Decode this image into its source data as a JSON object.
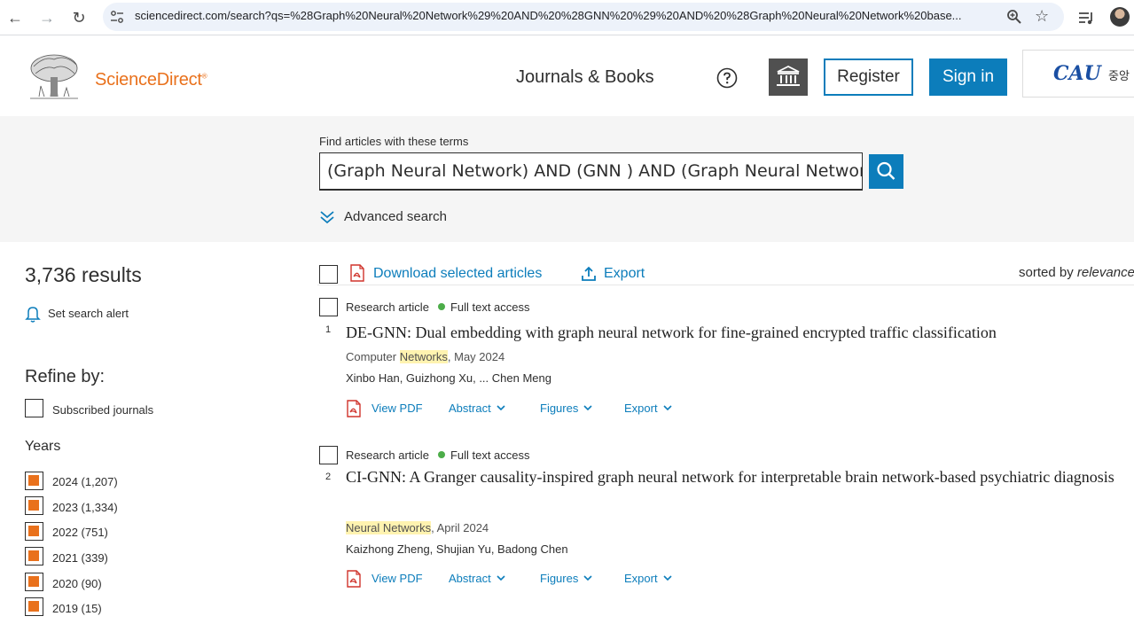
{
  "browser": {
    "url": "sciencedirect.com/search?qs=%28Graph%20Neural%20Network%29%20AND%20%28GNN%20%29%20AND%20%28Graph%20Neural%20Network%20base..."
  },
  "header": {
    "brand": "ScienceDirect",
    "brand_mark": "®",
    "journals_books": "Journals & Books",
    "register_label": "Register",
    "signin_label": "Sign in",
    "institution_logo_text": "CAU",
    "institution_name_partial": "중앙"
  },
  "search": {
    "label": "Find articles with these terms",
    "query": "(Graph Neural Network) AND (GNN ) AND (Graph Neural Network based Approaches)",
    "advanced_label": "Advanced search"
  },
  "sidebar": {
    "results_count": "3,736 results",
    "alert_label": "Set search alert",
    "refine_title": "Refine by:",
    "subscribed_label": "Subscribed journals",
    "years_title": "Years",
    "years": [
      {
        "label": "2024 (1,207)",
        "checked": true
      },
      {
        "label": "2023 (1,334)",
        "checked": true
      },
      {
        "label": "2022 (751)",
        "checked": true
      },
      {
        "label": "2021 (339)",
        "checked": true
      },
      {
        "label": "2020 (90)",
        "checked": true
      },
      {
        "label": "2019 (15)",
        "checked": true
      }
    ]
  },
  "toolbar": {
    "download_label": "Download selected articles",
    "export_label": "Export",
    "sorted_prefix": "sorted by ",
    "sorted_value": "relevance"
  },
  "results": [
    {
      "number": "1",
      "type": "Research article",
      "access": "Full text access",
      "title": "DE-GNN: Dual embedding with graph neural network for fine-grained encrypted traffic classification",
      "source_pre": "Computer ",
      "source_hl": "Networks",
      "source_post": ", May 2024",
      "authors": "Xinbo Han, Guizhong Xu, ... Chen Meng",
      "view_pdf": "View PDF",
      "abstract": "Abstract",
      "figures": "Figures",
      "export": "Export"
    },
    {
      "number": "2",
      "type": "Research article",
      "access": "Full text access",
      "title": "CI-GNN: A Granger causality-inspired graph neural network for interpretable brain network-based psychiatric diagnosis",
      "source_hl1": "Neural",
      "source_hl2": "Networks",
      "source_post": ", April 2024",
      "authors": "Kaizhong Zheng, Shujian Yu, Badong Chen",
      "view_pdf": "View PDF",
      "abstract": "Abstract",
      "figures": "Figures",
      "export": "Export"
    }
  ],
  "colors": {
    "accent_blue": "#0c7dbb",
    "brand_orange": "#e9711c",
    "access_green": "#4cad49",
    "highlight": "#fff3b0"
  }
}
